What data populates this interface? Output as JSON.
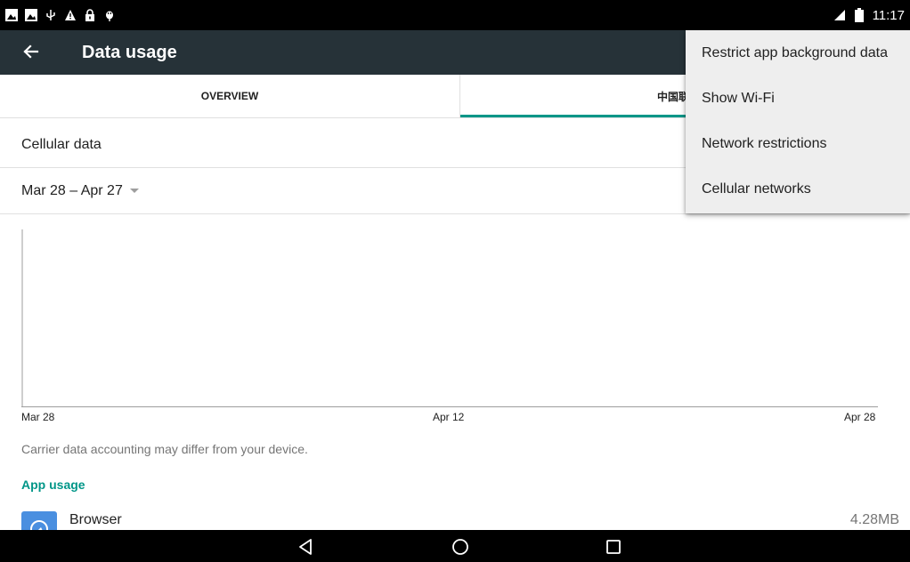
{
  "status_bar": {
    "time": "11:17",
    "left_icons": [
      "image-icon",
      "image-icon",
      "usb-icon",
      "warning-icon",
      "lock-icon",
      "debug-icon"
    ],
    "right_icons": [
      "signal-icon",
      "wifi-icon",
      "sim-icon",
      "battery-icon"
    ]
  },
  "appbar": {
    "title": "Data usage"
  },
  "tabs": [
    {
      "label": "OVERVIEW"
    },
    {
      "label": "中国联通"
    }
  ],
  "rows": {
    "cellular_data": "Cellular data",
    "cycle": "Mar 28 – Apr 27"
  },
  "chart_data": {
    "type": "line",
    "x": [
      "Mar 28",
      "Apr 12",
      "Apr 28"
    ],
    "series": [],
    "xlabel": "",
    "ylabel": ""
  },
  "note": "Carrier data accounting may differ from your device.",
  "app_usage": {
    "title": "App usage",
    "apps": [
      {
        "name": "Browser",
        "size": "4.28MB"
      }
    ]
  },
  "overflow_menu": {
    "items": [
      {
        "label": "Restrict app background data"
      },
      {
        "label": "Show Wi-Fi"
      },
      {
        "label": "Network restrictions"
      },
      {
        "label": "Cellular networks"
      }
    ]
  },
  "colors": {
    "appbar": "#263238",
    "accent": "#009688",
    "menu_bg": "#eeeeee"
  }
}
